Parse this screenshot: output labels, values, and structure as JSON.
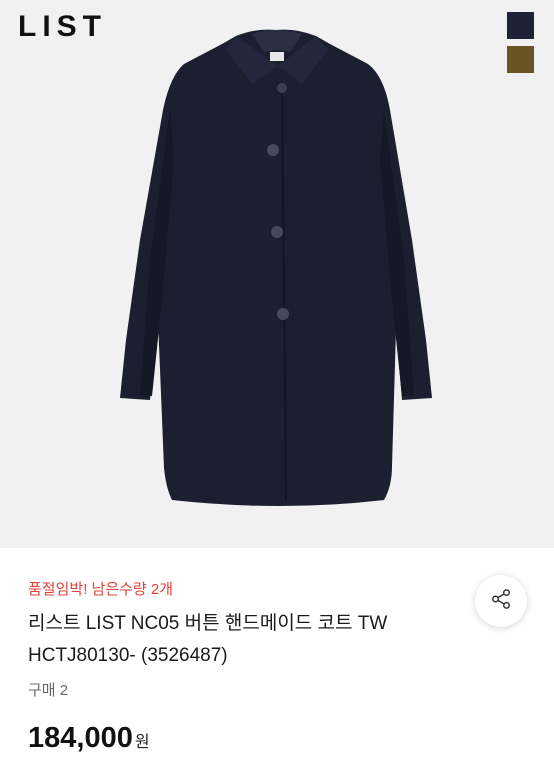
{
  "brand": {
    "logo_text": "LIST"
  },
  "product_image": {
    "icon": "coat-image",
    "color_options": [
      {
        "name": "navy",
        "color": "#1d2238"
      },
      {
        "name": "brown",
        "color": "#6a5424"
      }
    ]
  },
  "product": {
    "stock_notice": "품절임박! 남은수량 2개",
    "title": "리스트 LIST NC05 버튼 핸드메이드 코트 TW HCTJ80130- (3526487)",
    "purchase_count": "구매 2",
    "price": "184,000",
    "currency": "원"
  },
  "actions": {
    "share_icon": "share-icon"
  },
  "colors": {
    "accent_red": "#e5413a",
    "coat": "#1b1f30",
    "image_bg": "#f1f1f1"
  }
}
